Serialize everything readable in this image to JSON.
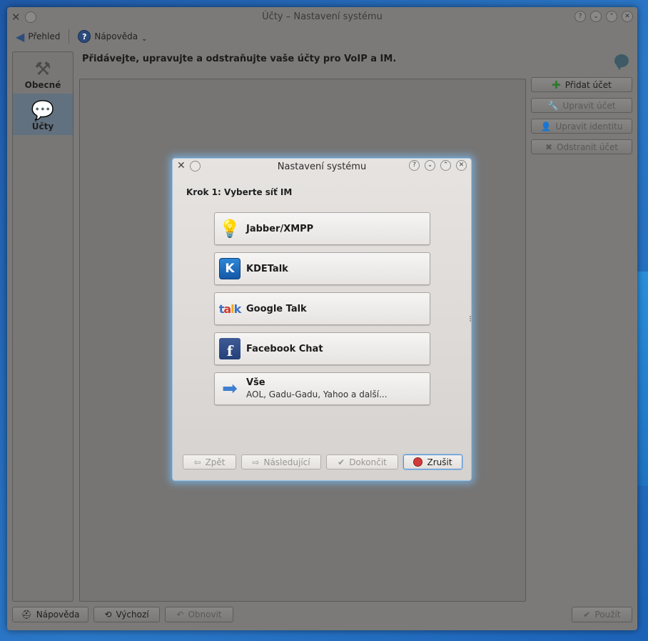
{
  "window": {
    "title": "Účty – Nastavení systému"
  },
  "toolbar": {
    "overview_label": "Přehled",
    "help_label": "Nápověda"
  },
  "sidebar": {
    "items": [
      {
        "label": "Obecné",
        "icon": "tools-icon"
      },
      {
        "label": "Účty",
        "icon": "chat-bubble-icon",
        "selected": true
      }
    ]
  },
  "page": {
    "header": "Přidávejte, upravujte a odstraňujte vaše účty pro VoIP a IM."
  },
  "side_buttons": {
    "add": "Přidat účet",
    "edit": "Upravit účet",
    "edit_identity": "Upravit identitu",
    "remove": "Odstranit účet"
  },
  "bottom": {
    "help": "Nápověda",
    "defaults": "Výchozí",
    "reset": "Obnovit",
    "apply": "Použít"
  },
  "dialog": {
    "title": "Nastavení systému",
    "step": "Krok 1: Vyberte síť IM",
    "networks": [
      {
        "label": "Jabber/XMPP",
        "icon": "lightbulb-icon"
      },
      {
        "label": "KDETalk",
        "icon": "kde-logo-icon"
      },
      {
        "label": "Google Talk",
        "icon": "google-talk-icon"
      },
      {
        "label": "Facebook Chat",
        "icon": "facebook-icon"
      },
      {
        "label": "Vše",
        "sublabel": "AOL, Gadu-Gadu, Yahoo a další...",
        "icon": "arrow-right-icon"
      }
    ],
    "buttons": {
      "back": "Zpět",
      "next": "Následující",
      "finish": "Dokončit",
      "cancel": "Zrušit"
    }
  },
  "colors": {
    "desktop": "#2b78c8",
    "window_bg": "#7b7a79",
    "dialog_glow": "#78befa",
    "selected_category": "#62717f"
  }
}
